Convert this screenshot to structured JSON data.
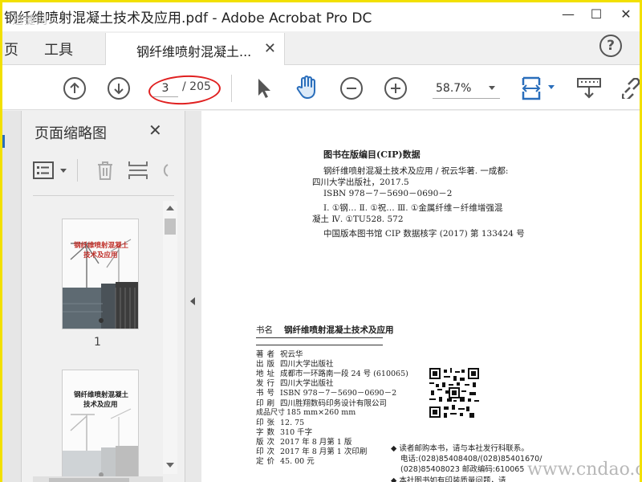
{
  "window": {
    "title": "钢纤维喷射混凝土技术及应用.pdf - Adobe Acrobat Pro DC",
    "watermark": "迅捷网",
    "controls": {
      "minimize": "—",
      "maximize": "☐",
      "close": "✕"
    }
  },
  "tabs": {
    "home_partial": "页",
    "tools": "工具",
    "document": "钢纤维喷射混凝土...",
    "close": "✕",
    "help": "?"
  },
  "toolbar": {
    "current_page": "3",
    "total_pages": "/ 205",
    "zoom": "58.7%"
  },
  "side_panel": {
    "title": "页面缩略图",
    "close": "✕",
    "thumbnails": [
      {
        "label": "1",
        "book_title_1": "钢纤维喷射混凝土",
        "book_title_2": "技术及应用"
      },
      {
        "label": "",
        "book_title_1": "钢纤维喷射混凝土",
        "book_title_2": "技术及应用"
      }
    ]
  },
  "page": {
    "cip_title": "图书在版编目(CIP)数据",
    "cip_lines": [
      "钢纤维喷射混凝土技术及应用 / 祝云华著. 一成都:",
      "四川大学出版社，2017.5",
      "ISBN 978－7－5690－0690－2",
      "Ⅰ. ①钢…   Ⅱ. ①祝…   Ⅲ. ①金属纤维－纤维增强混",
      "凝土  Ⅳ. ①TU528. 572",
      "中国版本图书馆 CIP 数据核字 (2017) 第 133424 号"
    ],
    "book_name_key": "书名",
    "book_name_value": "钢纤维喷射混凝土技术及应用",
    "info": [
      {
        "k": "著者",
        "v": "祝云华"
      },
      {
        "k": "出版",
        "v": "四川大学出版社"
      },
      {
        "k": "地址",
        "v": "成都市一环路南一段 24 号 (610065)"
      },
      {
        "k": "发行",
        "v": "四川大学出版社"
      },
      {
        "k": "书号",
        "v": "ISBN 978－7－5690－0690－2"
      },
      {
        "k": "印刷",
        "v": "四川胜翔数码印务设计有限公司"
      },
      {
        "k": "成品尺寸",
        "v": "185 mm×260 mm"
      },
      {
        "k": "印张",
        "v": "12. 75"
      },
      {
        "k": "字数",
        "v": "310 千字"
      },
      {
        "k": "版次",
        "v": "2017 年 8 月第 1 版"
      },
      {
        "k": "印次",
        "v": "2017 年 8 月第 1 次印刷"
      },
      {
        "k": "定价",
        "v": "45. 00 元"
      }
    ],
    "notes": [
      "◆ 读者邮购本书，请与本社发行科联系。",
      "电话:(028)85408408/(028)85401670/",
      "(028)85408023  邮政编码:610065",
      "◆ 本社图书如有印装质量问题，请"
    ],
    "watermark": "www.cndao.com"
  },
  "colors": {
    "accent": "#2a6ebb",
    "annotation": "#e02020",
    "frame": "#f2e000"
  }
}
